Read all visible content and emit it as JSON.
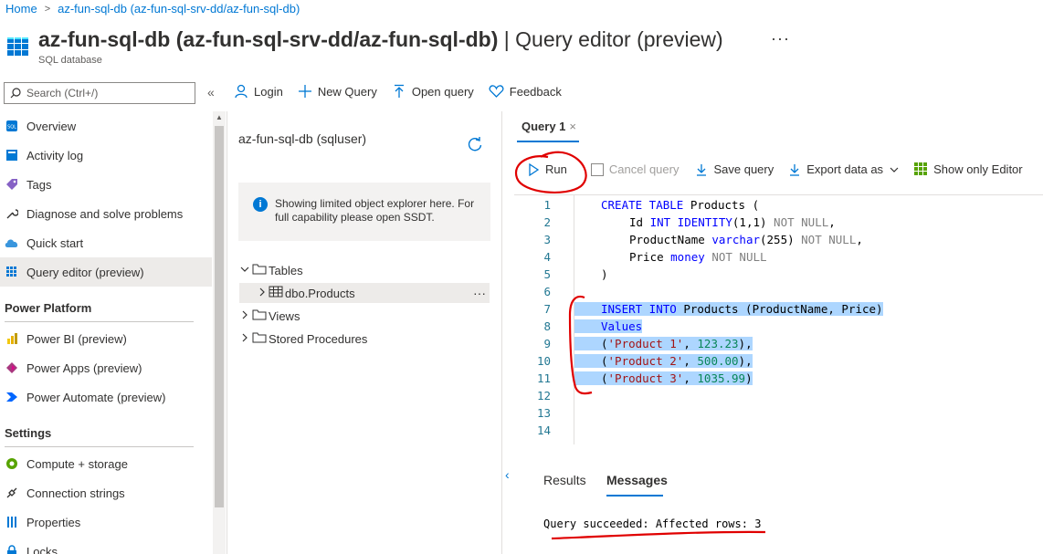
{
  "breadcrumb": {
    "home": "Home",
    "current": "az-fun-sql-db (az-fun-sql-srv-dd/az-fun-sql-db)"
  },
  "header": {
    "title_main": "az-fun-sql-db (az-fun-sql-srv-dd/az-fun-sql-db)",
    "title_sep": " | ",
    "title_blade": "Query editor (preview)",
    "subtitle": "SQL database",
    "more": "···"
  },
  "search": {
    "placeholder": "Search (Ctrl+/)",
    "collapse": "«"
  },
  "toolbar": {
    "login": "Login",
    "new_query": "New Query",
    "open_query": "Open query",
    "feedback": "Feedback"
  },
  "sidebar": {
    "items": [
      {
        "label": "Overview",
        "icon": "sql-db-icon"
      },
      {
        "label": "Activity log",
        "icon": "activity-log-icon"
      },
      {
        "label": "Tags",
        "icon": "tag-icon"
      },
      {
        "label": "Diagnose and solve problems",
        "icon": "wrench-icon"
      },
      {
        "label": "Quick start",
        "icon": "cloud-icon"
      },
      {
        "label": "Query editor (preview)",
        "icon": "query-editor-icon",
        "active": true
      }
    ],
    "section_power": "Power Platform",
    "power_items": [
      {
        "label": "Power BI (preview)",
        "icon": "power-bi-icon"
      },
      {
        "label": "Power Apps (preview)",
        "icon": "power-apps-icon"
      },
      {
        "label": "Power Automate (preview)",
        "icon": "power-automate-icon"
      }
    ],
    "section_settings": "Settings",
    "settings_items": [
      {
        "label": "Compute + storage",
        "icon": "compute-icon"
      },
      {
        "label": "Connection strings",
        "icon": "plug-icon"
      },
      {
        "label": "Properties",
        "icon": "properties-icon"
      },
      {
        "label": "Locks",
        "icon": "lock-icon"
      }
    ]
  },
  "explorer": {
    "connection": "az-fun-sql-db (sqluser)",
    "info": "Showing limited object explorer here. For full capability please open SSDT.",
    "tree": {
      "tables": "Tables",
      "table_item": "dbo.Products",
      "views": "Views",
      "procedures": "Stored Procedures",
      "more": "···"
    }
  },
  "query": {
    "tab_label": "Query 1",
    "tab_close": "×",
    "run": "Run",
    "cancel": "Cancel query",
    "save": "Save query",
    "export": "Export data as",
    "show_editor": "Show only Editor"
  },
  "editor": {
    "line_numbers": [
      "1",
      "2",
      "3",
      "4",
      "5",
      "6",
      "7",
      "8",
      "9",
      "10",
      "11",
      "12",
      "13",
      "14"
    ],
    "l1_kw": "CREATE TABLE",
    "l1_rest": " Products (",
    "l2_id": "Id ",
    "l2_type": "INT IDENTITY",
    "l2_args": "(1,1) ",
    "l2_nn": "NOT NULL",
    "l2_end": ",",
    "l3_id": "ProductName ",
    "l3_type": "varchar",
    "l3_args": "(255) ",
    "l3_nn": "NOT NULL",
    "l3_end": ",",
    "l4_id": "Price ",
    "l4_type": "money",
    "l4_nn": " NOT NULL",
    "l5": ")",
    "l7_kw": "INSERT INTO",
    "l7_rest": " Products (ProductName, Price)",
    "l8_kw": "Values",
    "l9_open": "(",
    "l9_str": "'Product 1'",
    "l9_sep": ", ",
    "l9_num": "123.23",
    "l9_end": "),",
    "l10_open": "(",
    "l10_str": "'Product 2'",
    "l10_sep": ", ",
    "l10_num": "500.00",
    "l10_end": "),",
    "l11_open": "(",
    "l11_str": "'Product 3'",
    "l11_sep": ", ",
    "l11_num": "1035.99",
    "l11_end": ")"
  },
  "results": {
    "collapse": "‹",
    "tab_results": "Results",
    "tab_messages": "Messages",
    "message": "Query succeeded: Affected rows: 3"
  },
  "colors": {
    "accent": "#0078d4",
    "annotation": "#e00000",
    "selection": "#add6ff"
  }
}
